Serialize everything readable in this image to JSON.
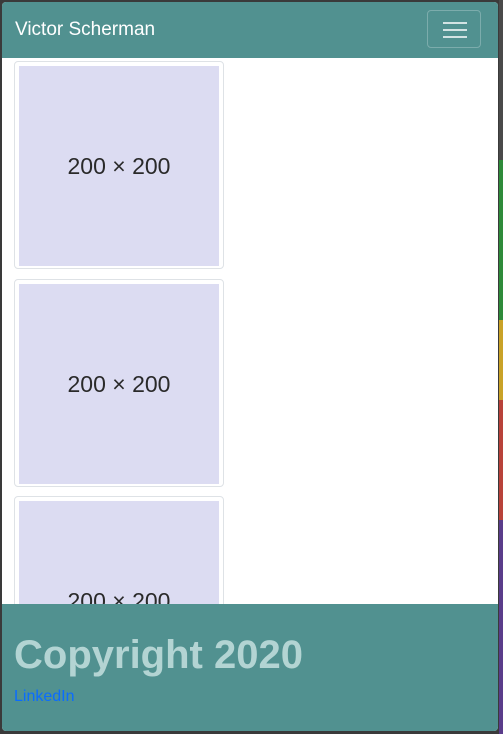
{
  "navbar": {
    "brand": "Victor Scherman",
    "menu_icon": "hamburger-menu-icon"
  },
  "gallery": {
    "items": [
      {
        "label": "200 × 200"
      },
      {
        "label": "200 × 200"
      },
      {
        "label": "200 × 200"
      }
    ]
  },
  "footer": {
    "copyright": "Copyright 2020",
    "link": "LinkedIn"
  },
  "colors": {
    "navbar": "#519190",
    "footer": "#519190",
    "placeholder": "#dcdcf2",
    "link": "#0a6cff"
  }
}
